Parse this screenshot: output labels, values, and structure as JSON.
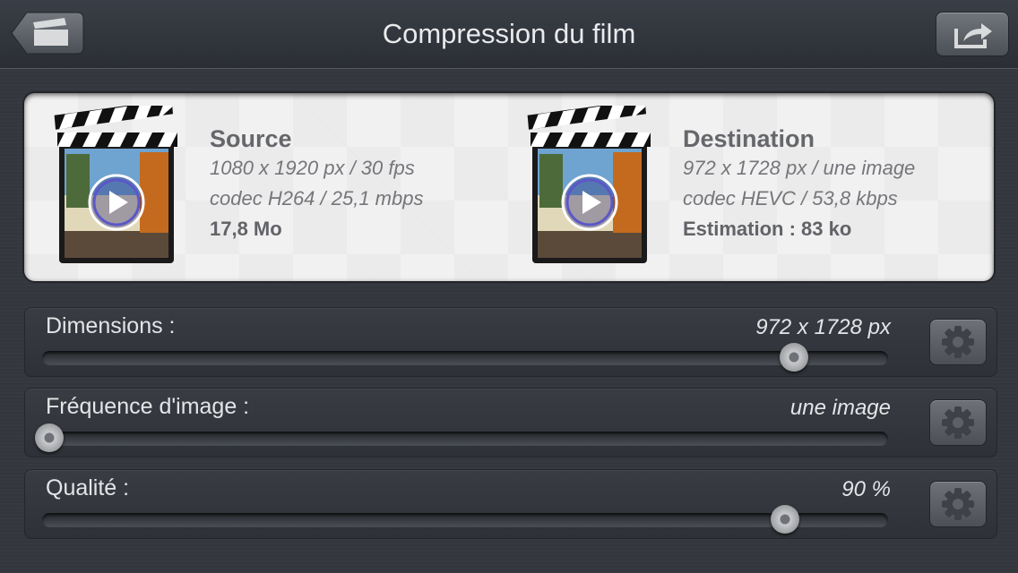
{
  "navbar": {
    "title": "Compression du film",
    "back_icon": "clapperboard-icon",
    "share_icon": "share-icon"
  },
  "source": {
    "title": "Source",
    "line1": "1080 x 1920 px / 30 fps",
    "line2": "codec H264 / 25,1 mbps",
    "size": "17,8 Mo"
  },
  "destination": {
    "title": "Destination",
    "line1": "972 x 1728 px / une image",
    "line2": "codec HEVC / 53,8 kbps",
    "estimate": "Estimation : 83 ko"
  },
  "settings": [
    {
      "label": "Dimensions :",
      "value": "972 x 1728 px",
      "slider_fraction": 0.895
    },
    {
      "label": "Fréquence d'image :",
      "value": "une image",
      "slider_fraction": 0.0
    },
    {
      "label": "Qualité :",
      "value": "90 %",
      "slider_fraction": 0.885
    }
  ]
}
